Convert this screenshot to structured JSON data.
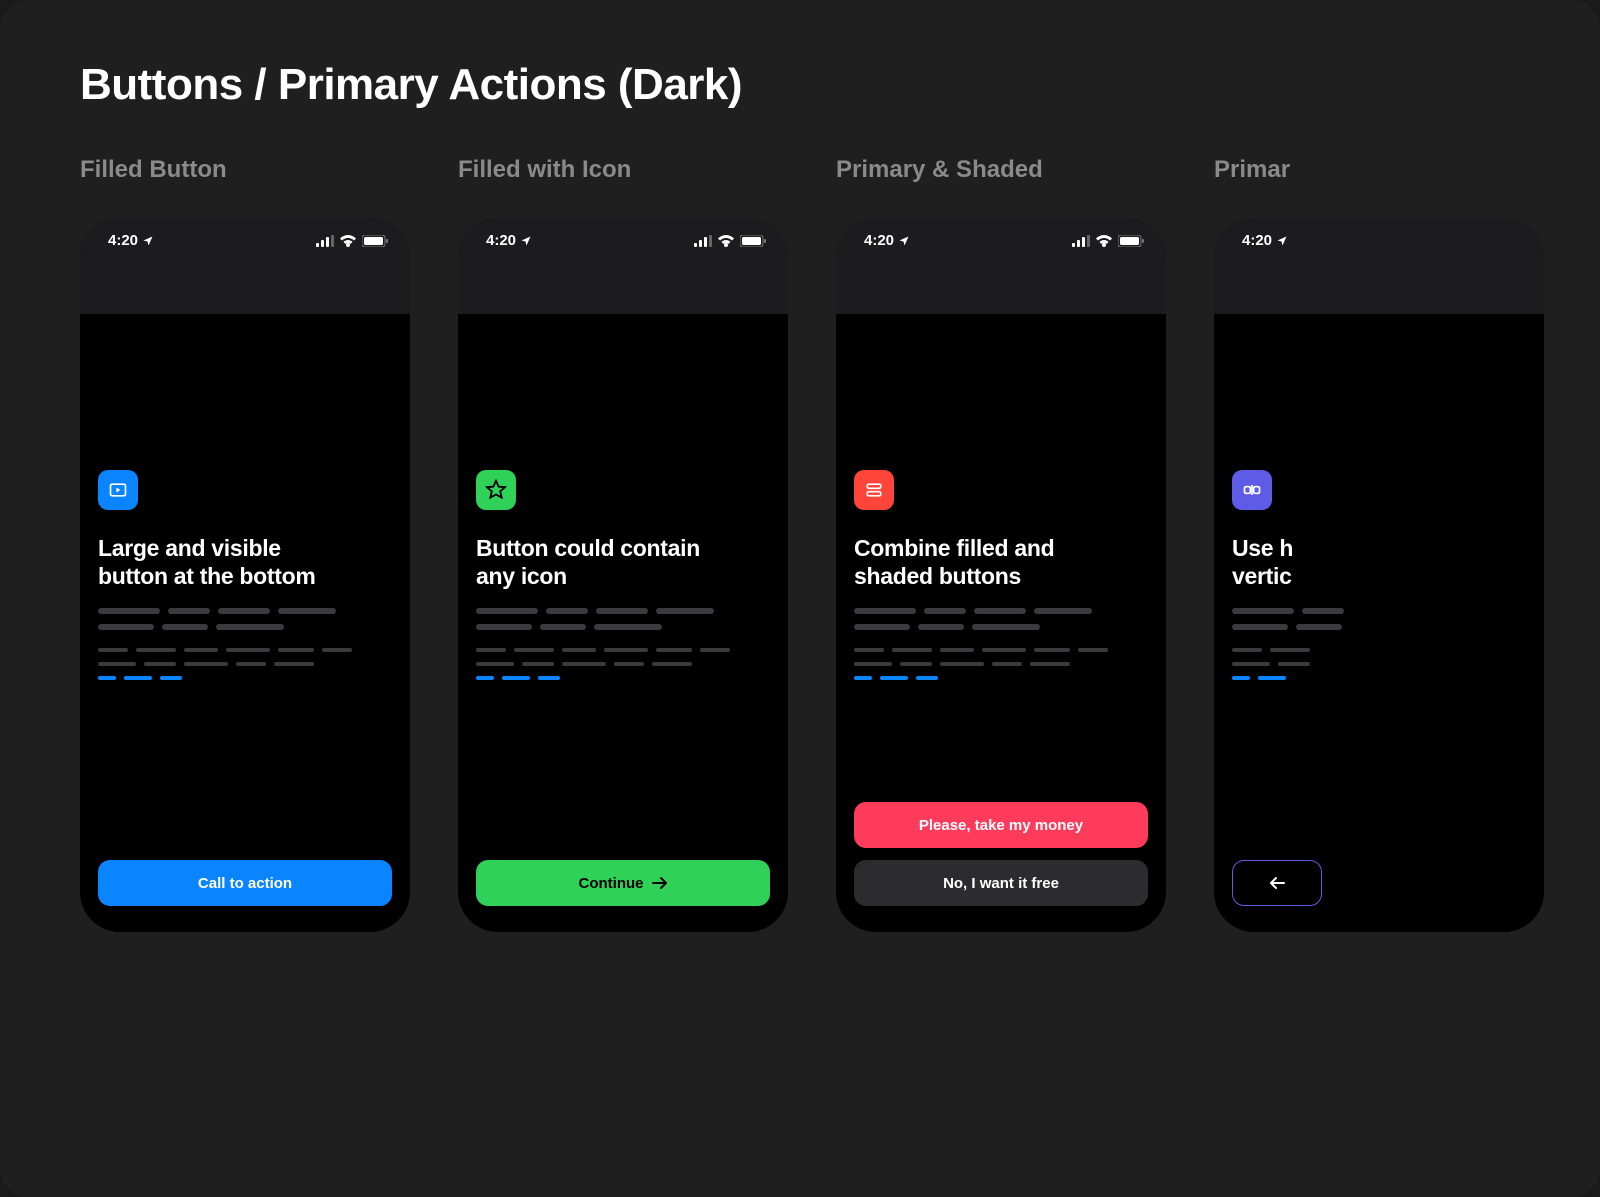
{
  "page_title": "Buttons / Primary Actions (Dark)",
  "status_time": "4:20",
  "variants": [
    {
      "label": "Filled Button",
      "icon": "play-box-icon",
      "icon_color": "blue",
      "heading_line1": "Large and visible",
      "heading_line2": "button at the bottom",
      "buttons": [
        {
          "label": "Call to action",
          "style": "blue",
          "icon": null
        }
      ]
    },
    {
      "label": "Filled with Icon",
      "icon": "star-icon",
      "icon_color": "green",
      "heading_line1": "Button could contain",
      "heading_line2": "any icon",
      "buttons": [
        {
          "label": "Continue",
          "style": "green",
          "icon": "arrow-right-icon"
        }
      ]
    },
    {
      "label": "Primary & Shaded",
      "icon": "rows-icon",
      "icon_color": "red",
      "heading_line1": "Combine filled and",
      "heading_line2": "shaded buttons",
      "buttons": [
        {
          "label": "Please, take my money",
          "style": "pink",
          "icon": null
        },
        {
          "label": "No, I want it free",
          "style": "shaded",
          "icon": null
        }
      ]
    },
    {
      "label": "Primar",
      "icon": "split-icon",
      "icon_color": "purple",
      "heading_line1": "Use h",
      "heading_line2": "vertic",
      "buttons": [
        {
          "label": "",
          "style": "outline-purple",
          "icon": "arrow-left-icon"
        }
      ]
    }
  ]
}
